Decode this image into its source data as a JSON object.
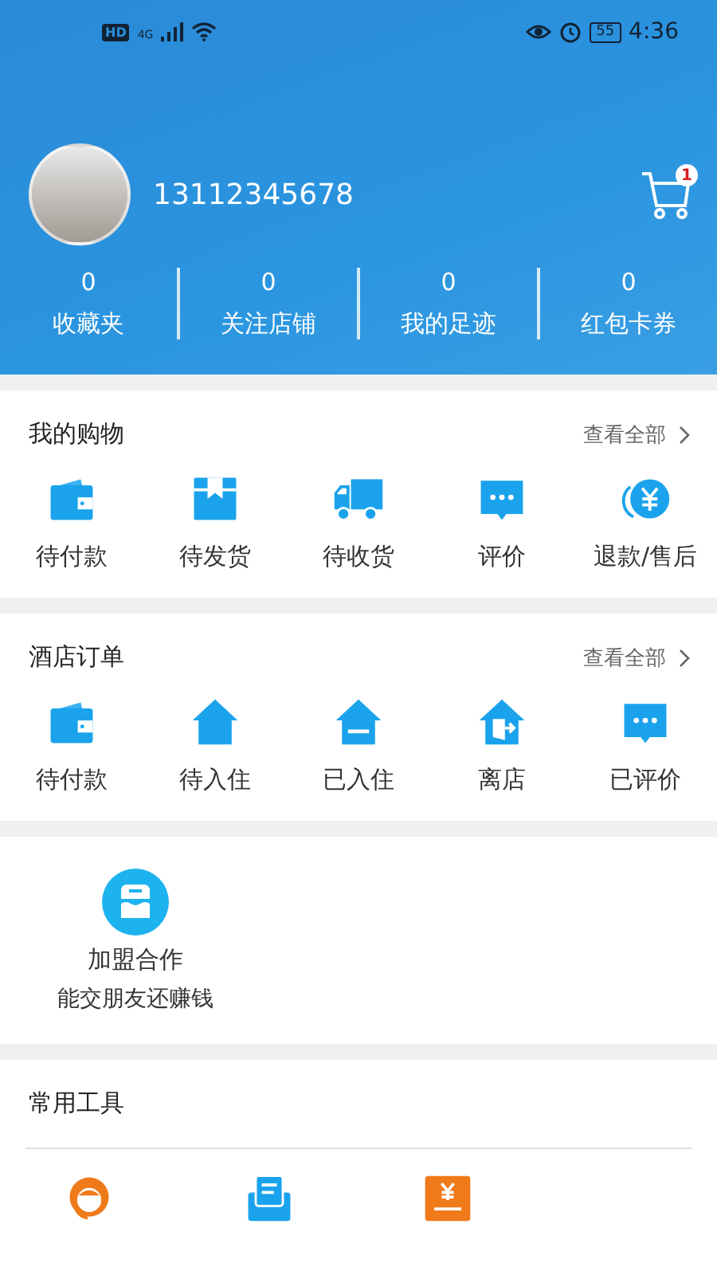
{
  "status_bar": {
    "hd": "HD",
    "network": "4G",
    "battery": "55",
    "time": "4:36"
  },
  "profile": {
    "phone": "13112345678",
    "cart_badge": "1"
  },
  "stats": [
    {
      "value": "0",
      "label": "收藏夹"
    },
    {
      "value": "0",
      "label": "关注店铺"
    },
    {
      "value": "0",
      "label": "我的足迹"
    },
    {
      "value": "0",
      "label": "红包卡券"
    }
  ],
  "sections": [
    {
      "title": "我的购物",
      "link": "查看全部",
      "items": [
        {
          "kind": "wallet",
          "label": "待付款"
        },
        {
          "kind": "box",
          "label": "待发货"
        },
        {
          "kind": "truck",
          "label": "待收货"
        },
        {
          "kind": "chat",
          "label": "评价"
        },
        {
          "kind": "refund",
          "label": "退款/售后"
        }
      ]
    },
    {
      "title": "酒店订单",
      "link": "查看全部",
      "items": [
        {
          "kind": "wallet",
          "label": "待付款"
        },
        {
          "kind": "house",
          "label": "待入住"
        },
        {
          "kind": "house-minus",
          "label": "已入住"
        },
        {
          "kind": "house-exit",
          "label": "离店"
        },
        {
          "kind": "chat",
          "label": "已评价"
        }
      ]
    }
  ],
  "join": {
    "title": "加盟合作",
    "subtitle": "能交朋友还赚钱"
  },
  "tools": {
    "title": "常用工具",
    "items": [
      {
        "kind": "headset"
      },
      {
        "kind": "mail"
      },
      {
        "kind": "receipt"
      }
    ]
  }
}
